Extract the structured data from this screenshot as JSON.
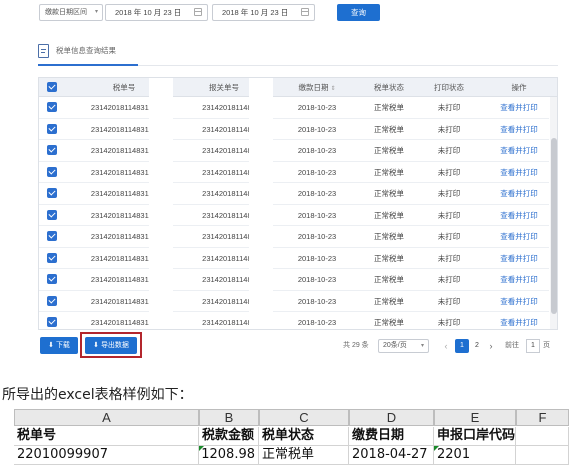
{
  "filter": {
    "date_type": "缴款日期区间",
    "date_from": "2018 年 10 月 23 日",
    "date_to": "2018 年 10 月 23 日",
    "query_label": "查询"
  },
  "panel": {
    "title": "税单信息查询结果"
  },
  "table": {
    "headers": {
      "tax_no": "税单号",
      "customs_no": "报关单号",
      "pay_date": "缴款日期",
      "status": "税单状态",
      "print_status": "打印状态",
      "action": "操作"
    },
    "rows": [
      {
        "tax_no": "2314201811483132",
        "customs_no": "2314201811483",
        "pay_date": "2018-10-23",
        "status": "正常税单",
        "print_status": "未打印",
        "action": "查看并打印"
      },
      {
        "tax_no": "2314201811483133",
        "customs_no": "2314201811483",
        "pay_date": "2018-10-23",
        "status": "正常税单",
        "print_status": "未打印",
        "action": "查看并打印"
      },
      {
        "tax_no": "2314201811483133",
        "customs_no": "2314201811483",
        "pay_date": "2018-10-23",
        "status": "正常税单",
        "print_status": "未打印",
        "action": "查看并打印"
      },
      {
        "tax_no": "2314201811483134",
        "customs_no": "2314201811483",
        "pay_date": "2018-10-23",
        "status": "正常税单",
        "print_status": "未打印",
        "action": "查看并打印"
      },
      {
        "tax_no": "2314201811483134",
        "customs_no": "2314201811483",
        "pay_date": "2018-10-23",
        "status": "正常税单",
        "print_status": "未打印",
        "action": "查看并打印"
      },
      {
        "tax_no": "2314201811483135",
        "customs_no": "2314201811483",
        "pay_date": "2018-10-23",
        "status": "正常税单",
        "print_status": "未打印",
        "action": "查看并打印"
      },
      {
        "tax_no": "2314201811483136",
        "customs_no": "2314201811483",
        "pay_date": "2018-10-23",
        "status": "正常税单",
        "print_status": "未打印",
        "action": "查看并打印"
      },
      {
        "tax_no": "2314201811483136",
        "customs_no": "2314201811483",
        "pay_date": "2018-10-23",
        "status": "正常税单",
        "print_status": "未打印",
        "action": "查看并打印"
      },
      {
        "tax_no": "2314201811483136",
        "customs_no": "2314201811483",
        "pay_date": "2018-10-23",
        "status": "正常税单",
        "print_status": "未打印",
        "action": "查看并打印"
      },
      {
        "tax_no": "2314201811483136",
        "customs_no": "2314201811483",
        "pay_date": "2018-10-23",
        "status": "正常税单",
        "print_status": "未打印",
        "action": "查看并打印"
      },
      {
        "tax_no": "2314201811483136",
        "customs_no": "2314201811483",
        "pay_date": "2018-10-23",
        "status": "正常税单",
        "print_status": "未打印",
        "action": "查看并打印"
      }
    ]
  },
  "actions": {
    "download_label": "下载",
    "export_label": "导出数据"
  },
  "pager": {
    "total": "共 29 条",
    "page_size": "20条/页",
    "prev": "‹",
    "page1": "1",
    "page2": "2",
    "next": "›",
    "goto": "前往",
    "current_input": "1",
    "page_unit": "页"
  },
  "caption": "所导出的excel表格样例如下：",
  "excel": {
    "columns": [
      "A",
      "B",
      "C",
      "D",
      "E",
      "F"
    ],
    "header_row": [
      "税单号",
      "税款金额",
      "税单状态",
      "缴费日期",
      "申报口岸代码",
      ""
    ],
    "data_row": [
      "22010099907",
      "1208.98",
      "正常税单",
      "2018-04-27",
      "2201",
      ""
    ]
  },
  "colors": {
    "primary": "#1e6fd0",
    "highlight_border": "#b3262d",
    "link": "#2c6fcf"
  }
}
